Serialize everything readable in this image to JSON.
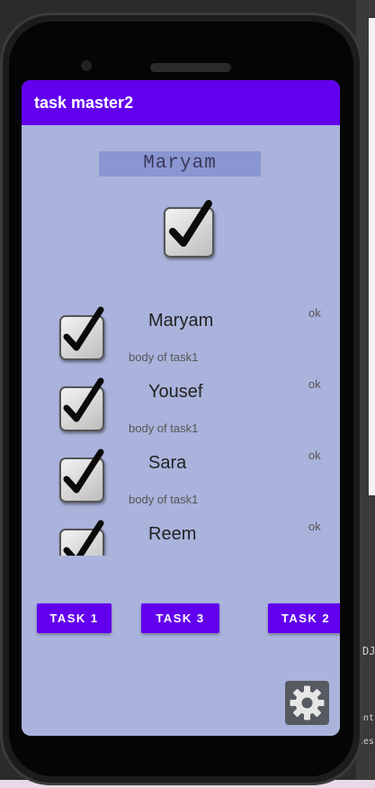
{
  "app": {
    "title": "task master2"
  },
  "user": {
    "name": "Maryam"
  },
  "tasks": [
    {
      "title": "Maryam",
      "body": "body of task1",
      "status": "ok"
    },
    {
      "title": "Yousef",
      "body": "body of task1",
      "status": "ok"
    },
    {
      "title": "Sara",
      "body": "body of task1",
      "status": "ok"
    },
    {
      "title": "Reem",
      "body": "",
      "status": "ok"
    }
  ],
  "buttons": {
    "task1": "TASK 1",
    "task3": "TASK 3",
    "task2": "TASK 2"
  },
  "ide": {
    "right_text": "DJ",
    "bottom_text1": "ent",
    "bottom_text2": "ces"
  },
  "icons": {
    "settings": "gear-icon",
    "check": "checkmark-icon"
  },
  "colors": {
    "accent": "#6200ee",
    "screen_bg": "#aab3dc",
    "field_bg": "#8a96d2",
    "settings_bg": "#565a61"
  }
}
